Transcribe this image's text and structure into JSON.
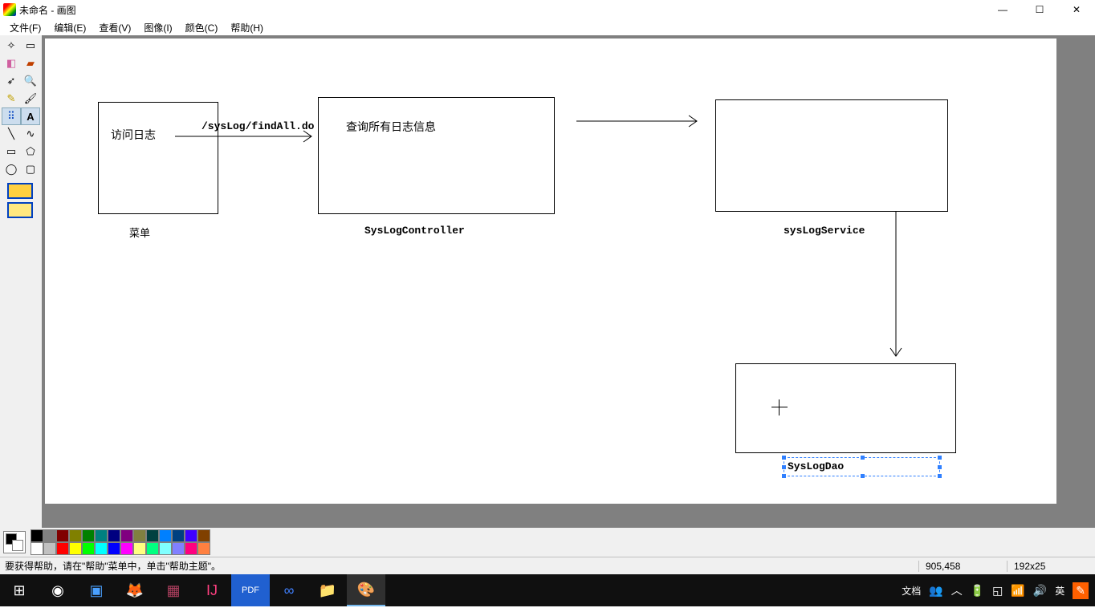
{
  "window": {
    "title": "未命名 - 画图",
    "controls": {
      "min": "—",
      "max": "☐",
      "close": "✕"
    }
  },
  "menu": {
    "file": "文件(F)",
    "edit": "编辑(E)",
    "view": "查看(V)",
    "image": "图像(I)",
    "color": "颜色(C)",
    "help": "帮助(H)"
  },
  "canvas": {
    "box1_text": "访问日志",
    "box1_caption": "菜单",
    "arrow1_label": "/sysLog/findAll.do",
    "box2_text": "查询所有日志信息",
    "box2_caption": "SysLogController",
    "box3_caption": "sysLogService",
    "box4_caption": "SysLogDao"
  },
  "status": {
    "help_text": "要获得帮助，请在\"帮助\"菜单中，单击\"帮助主题\"。",
    "coords": "905,458",
    "selection": "192x25"
  },
  "palette_top": [
    "#000000",
    "#808080",
    "#800000",
    "#808000",
    "#008000",
    "#008080",
    "#000080",
    "#800080",
    "#808040",
    "#004040",
    "#0080ff",
    "#004080",
    "#4000ff",
    "#804000"
  ],
  "palette_bottom": [
    "#ffffff",
    "#c0c0c0",
    "#ff0000",
    "#ffff00",
    "#00ff00",
    "#00ffff",
    "#0000ff",
    "#ff00ff",
    "#ffff80",
    "#00ff80",
    "#80ffff",
    "#8080ff",
    "#ff0080",
    "#ff8040"
  ],
  "tools": {
    "free_select": "✧",
    "rect_select": "▭",
    "eraser": "◧",
    "fill": "▰",
    "picker": "➶",
    "zoom": "🔍",
    "pencil": "✎",
    "brush": "🖌",
    "spray": "⠿",
    "text": "A",
    "line": "╲",
    "curve": "∿",
    "rect": "▭",
    "poly": "⬠",
    "ellipse": "◯",
    "roundrect": "▢"
  },
  "taskbar": {
    "doc_label": "文档",
    "ime": "英"
  }
}
